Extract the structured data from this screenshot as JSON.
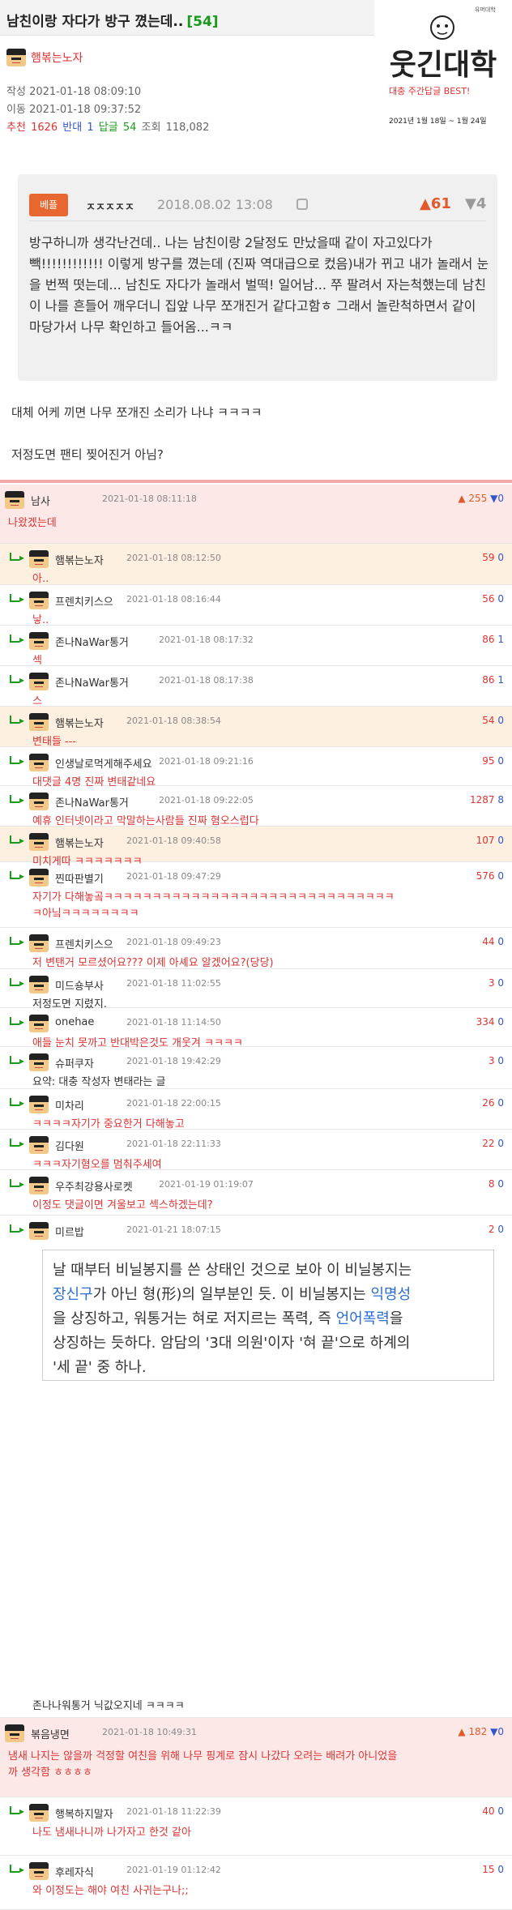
{
  "post": {
    "title": "남친이랑 자다가 방구 꼈는데..",
    "comment_count": "[54]",
    "author": "햄볶는노자",
    "written_label": "작성",
    "written": "2021-01-18 08:09:10",
    "moved_label": "이동",
    "moved": "2021-01-18 09:37:52",
    "recommend_label": "추천",
    "recommend": "1626",
    "oppose_label": "반대",
    "oppose": "1",
    "reply_label": "답글",
    "reply": "54",
    "views_label": "조회",
    "views": "118,082"
  },
  "logo": {
    "small": "유머대학",
    "title": "웃긴대학",
    "subtitle": "대충 주간답글 BEST!",
    "date": "2021년 1월 18일 ~ 1월 24일"
  },
  "quote": {
    "badge": "베플",
    "author": "ㅈㅈㅈㅈㅈ",
    "date": "2018.08.02 13:08",
    "up": "61",
    "down": "4",
    "text": "방구하니까 생각난건데.. 나는 남친이랑 2달정도 만났을때 같이 자고있다가 빽!!!!!!!!!!!! 이렇게 방구를 꼈는데 (진짜 역대급으로 컸음)내가 뀌고 내가 놀래서 눈을 번쩍 떳는데... 남친도 자다가 놀래서 벌떡! 일어남... 쭈 팔려서 자는척했는데 남친이 나를 흔들어 깨우더니 집앞 나무 쪼개진거 같다고함ㅎ 그래서 놀란척하면서 같이 마당가서 나무 확인하고 들어옴...ㅋㅋ"
  },
  "post_lines": [
    "대체 어케 끼면 나무 쪼개진 소리가 나냐 ㅋㅋㅋㅋ",
    "저정도면 팬티 찢어진거 아님?"
  ],
  "comments": [
    {
      "nick": "남사",
      "date": "2021-01-18 08:11:18",
      "up": "255",
      "down": "0",
      "body": "나왔겠는데"
    },
    {
      "nick": "햄볶는노자",
      "date": "2021-01-18 08:12:50",
      "up": "59",
      "down": "0",
      "body": "아.."
    },
    {
      "nick": "프렌치키스으",
      "date": "2021-01-18 08:16:44",
      "up": "56",
      "down": "0",
      "body": "낳.."
    },
    {
      "nick": "존나NaWar통거",
      "date": "2021-01-18 08:17:32",
      "up": "86",
      "down": "1",
      "body": "섹"
    },
    {
      "nick": "존나NaWar통거",
      "date": "2021-01-18 08:17:38",
      "up": "86",
      "down": "1",
      "body": "스"
    },
    {
      "nick": "햄볶는노자",
      "date": "2021-01-18 08:38:54",
      "up": "54",
      "down": "0",
      "body": "변태들 ---"
    },
    {
      "nick": "인생날로먹게해주세요",
      "date": "2021-01-18 09:21:16",
      "up": "95",
      "down": "0",
      "body": "대댓글 4명 진짜 변태같네요"
    },
    {
      "nick": "존나NaWar통거",
      "date": "2021-01-18 09:22:05",
      "up": "1287",
      "down": "8",
      "body": "예휴 인터넷이라고 막말하는사람들 진짜 혐오스럽다"
    },
    {
      "nick": "햄볶는노자",
      "date": "2021-01-18 09:40:58",
      "up": "107",
      "down": "0",
      "body": "미치게따 ㅋㅋㅋㅋㅋㅋㅋ"
    },
    {
      "nick": "찐따판별기",
      "date": "2021-01-18 09:47:29",
      "up": "576",
      "down": "0",
      "body": "자기가 다해놓곸ㅋㅋㅋㅋㅋㅋㅋㅋㅋㅋㅋㅋㅋㅋㅋㅋㅋㅋㅋㅋㅋㅋㅋㅋㅋㅋㅋㅋㅋㅋ",
      "body2": "ㅋ아닠ㅋㅋㅋㅋㅋㅋㅋㅋ"
    },
    {
      "nick": "프렌치키스으",
      "date": "2021-01-18 09:49:23",
      "up": "44",
      "down": "0",
      "body": "저 변탠거 모르셨어요??? 이제 아셰요 알겠어요?(당당)"
    },
    {
      "nick": "미드숑부사",
      "date": "2021-01-18 11:02:55",
      "up": "3",
      "down": "0",
      "body": "저정도면 지렸지."
    },
    {
      "nick": "onehae",
      "date": "2021-01-18 11:14:50",
      "up": "334",
      "down": "0",
      "body": "애들 눈치 못까고 반대박은것도 개웃겨 ㅋㅋㅋㅋ"
    },
    {
      "nick": "슈퍼쿠자",
      "date": "2021-01-18 19:42:29",
      "up": "3",
      "down": "0",
      "body": "요약: 대충 작성자 변태라는 글"
    },
    {
      "nick": "미차리",
      "date": "2021-01-18 22:00:15",
      "up": "26",
      "down": "0",
      "body": "ㅋㅋㅋㅋ자기가 중요한거 다해놓고"
    },
    {
      "nick": "김다원",
      "date": "2021-01-18 22:11:33",
      "up": "22",
      "down": "0",
      "body": "ㅋㅋㅋ자기혐오를 멈춰주세여"
    },
    {
      "nick": "우주최강용사로켓",
      "date": "2021-01-19 01:19:07",
      "up": "8",
      "down": "0",
      "body": "이정도 댓글이면 겨울보고 섹스하겠는데?"
    },
    {
      "nick": "미르밥",
      "date": "2021-01-21 18:07:15",
      "up": "2",
      "down": "0",
      "body": "존나나워통거 닉값오지네 ㅋㅋㅋㅋ"
    },
    {
      "nick": "볶음냉면",
      "date": "2021-01-18 10:49:31",
      "up": "182",
      "down": "0",
      "body": "냄새 나지는 않을까 걱정할 여친을 위해 나무 핑계로 잠시 나갔다 오려는 배려가 아니었을",
      "body2": "까 생각함 ㅎㅎㅎㅎ"
    },
    {
      "nick": "행복하지말자",
      "date": "2021-01-18 11:22:39",
      "up": "40",
      "down": "0",
      "body": "나도 냄새나니까 나가자고 한것 같아"
    },
    {
      "nick": "후레자식",
      "date": "2021-01-19 01:12:42",
      "up": "15",
      "down": "0",
      "body": "와 이정도는 해야 여친 사귀는구나;;"
    }
  ],
  "boxquote": {
    "l1": "날 때부터 비닐봉지를 쓴 상태인 것으로 보아 이 비닐봉지는",
    "l2a": "장신구",
    "l2b": "가 아닌 형(形)의 일부분인 듯. 이 비닐봉지는 ",
    "l2c": "익명성",
    "l3a": "을 상징하고, 워통거는 혀로 저지르는 폭력, 즉 ",
    "l3b": "언어폭력",
    "l3c": "을",
    "l4": "상징하는 듯하다. 암담의 '3대 의원'이자 '혀 끝'으로 하계의",
    "l5": "'세 끝' 중 하나."
  }
}
